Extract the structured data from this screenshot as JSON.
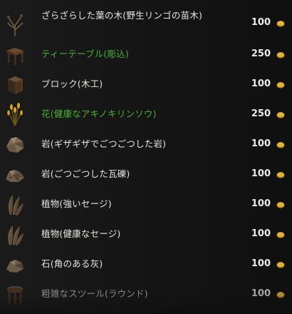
{
  "items": [
    {
      "name": "ざらざらした葉の木(野生リンゴの苗木)",
      "price": "100",
      "color": "white",
      "icon": "tree-icon"
    },
    {
      "name": "ティーテーブル(彫込)",
      "price": "250",
      "color": "green",
      "icon": "table-icon"
    },
    {
      "name": "ブロック(木工)",
      "price": "100",
      "color": "white",
      "icon": "block-icon"
    },
    {
      "name": "花(健康なアキノキリンソウ)",
      "price": "250",
      "color": "green",
      "icon": "flower-icon"
    },
    {
      "name": "岩(ギザギザでごつごつした岩)",
      "price": "100",
      "color": "white",
      "icon": "rock-icon"
    },
    {
      "name": "岩(ごつごつした瓦礫)",
      "price": "100",
      "color": "white",
      "icon": "rubble-icon"
    },
    {
      "name": "植物(強いセージ)",
      "price": "100",
      "color": "white",
      "icon": "sage-icon"
    },
    {
      "name": "植物(健康なセージ)",
      "price": "100",
      "color": "white",
      "icon": "sage-icon"
    },
    {
      "name": "石(角のある灰)",
      "price": "100",
      "color": "white",
      "icon": "stone-icon"
    },
    {
      "name": "粗雑なスツール(ラウンド)",
      "price": "100",
      "color": "grey",
      "icon": "stool-icon"
    }
  ],
  "currency_icon": "coin-icon",
  "colors": {
    "green_text": "#49b233",
    "white_text": "#e8e6e0",
    "coin": "#e0b33a"
  }
}
